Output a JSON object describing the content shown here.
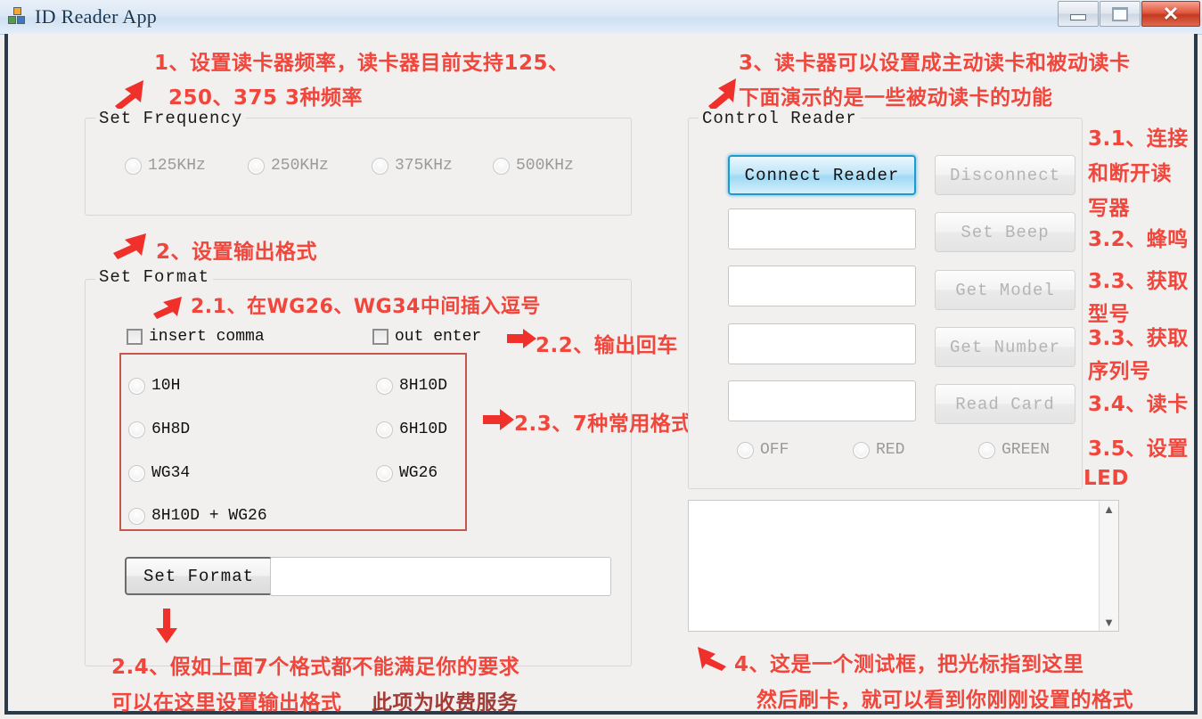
{
  "window": {
    "title": "ID Reader App",
    "icon": "app-blocks-icon",
    "buttons": {
      "minimize": "minimize",
      "maximize": "maximize",
      "close": "✕"
    }
  },
  "colors": {
    "annotation_red": "#f0463c",
    "annotation_dark_red": "#a33b36",
    "red_frame": "#c4584e",
    "focus_blue": "#1d9bd1",
    "window_bg": "#f1f0ef"
  },
  "frequency_group": {
    "legend": "Set Frequency",
    "options": [
      {
        "label": "125KHz",
        "selected": false,
        "enabled": false
      },
      {
        "label": "250KHz",
        "selected": false,
        "enabled": false
      },
      {
        "label": "375KHz",
        "selected": false,
        "enabled": false
      },
      {
        "label": "500KHz",
        "selected": false,
        "enabled": false
      }
    ]
  },
  "format_group": {
    "legend": "Set Format",
    "checkboxes": [
      {
        "label": "insert comma",
        "checked": false
      },
      {
        "label": "out enter",
        "checked": false
      }
    ],
    "format_options_left": [
      {
        "label": "10H",
        "selected": false
      },
      {
        "label": "6H8D",
        "selected": false
      },
      {
        "label": "WG34",
        "selected": false
      },
      {
        "label": "8H10D + WG26",
        "selected": false
      }
    ],
    "format_options_right": [
      {
        "label": "8H10D",
        "selected": false
      },
      {
        "label": "6H10D",
        "selected": false
      },
      {
        "label": "WG26",
        "selected": false
      }
    ],
    "set_format_button": "Set Format",
    "custom_format_value": "",
    "custom_format_placeholder": ""
  },
  "control_group": {
    "legend": "Control Reader",
    "buttons_left": [
      {
        "label": "Connect Reader",
        "state": "focused"
      }
    ],
    "buttons_right": [
      {
        "label": "Disconnect",
        "state": "disabled"
      },
      {
        "label": "Set Beep",
        "state": "disabled"
      },
      {
        "label": "Get Model",
        "state": "disabled"
      },
      {
        "label": "Get Number",
        "state": "disabled"
      },
      {
        "label": "Read Card",
        "state": "disabled"
      }
    ],
    "fields": [
      {
        "value": ""
      },
      {
        "value": ""
      },
      {
        "value": ""
      },
      {
        "value": ""
      }
    ],
    "led_options": [
      {
        "label": "OFF",
        "selected": false,
        "enabled": false
      },
      {
        "label": "RED",
        "selected": false,
        "enabled": false
      },
      {
        "label": "GREEN",
        "selected": false,
        "enabled": false
      }
    ]
  },
  "log_area": {
    "value": "",
    "scrollbar_up": "▲",
    "scrollbar_down": "▼"
  },
  "annotations": {
    "a1_line1": "1、设置读卡器频率，读卡器目前支持125、",
    "a1_line2": "250、375 3种频率",
    "a2": "2、设置输出格式",
    "a2_1": "2.1、在WG26、WG34中间插入逗号",
    "a2_2": "2.2、输出回车",
    "a2_3": "2.3、7种常用格式",
    "a2_4_line1": "2.4、假如上面7个格式都不能满足你的要求",
    "a2_4_line2": "可以在这里设置输出格式",
    "a2_4_line2b": "此项为收费服务",
    "a3_line1": "3、读卡器可以设置成主动读卡和被动读卡",
    "a3_line2": "下面演示的是一些被动读卡的功能",
    "a3_1_line1": "3.1、连接",
    "a3_1_line2": "和断开读",
    "a3_1_line3": "写器",
    "a3_2": "3.2、蜂鸣",
    "a3_3a_line1": "3.3、获取",
    "a3_3a_line2": "型号",
    "a3_3b_line1": "3.3、获取",
    "a3_3b_line2": "序列号",
    "a3_4": "3.4、读卡",
    "a3_5_line1": "3.5、设置",
    "a3_5_line2": "LED",
    "a4_line1": "4、这是一个测试框，把光标指到这里",
    "a4_line2": "然后刷卡，就可以看到你刚刚设置的格式"
  }
}
